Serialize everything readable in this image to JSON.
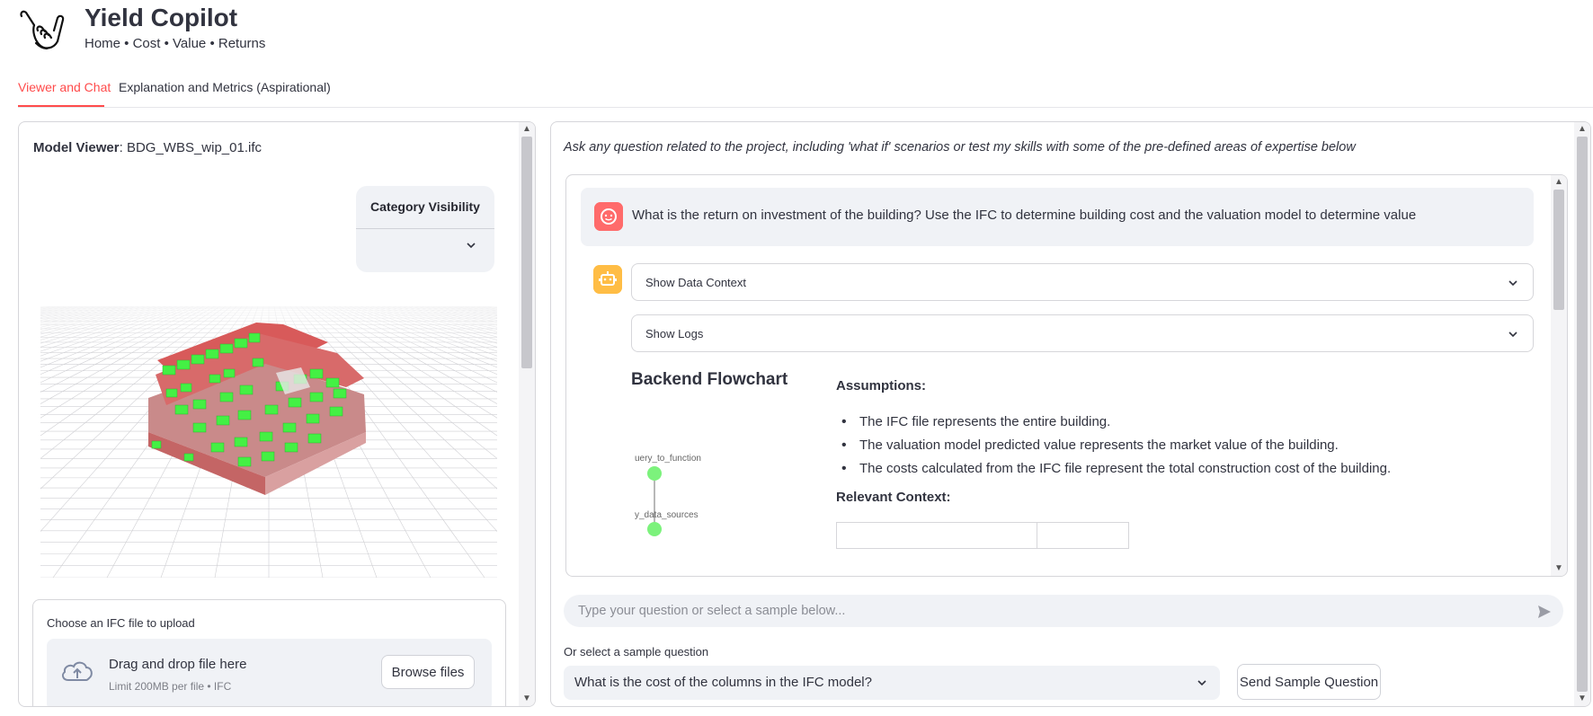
{
  "app": {
    "title": "Yield Copilot",
    "subtitle": "Home • Cost • Value • Returns",
    "logo_icon": "shaka-hand-icon"
  },
  "tabs": [
    {
      "label": "Viewer and Chat",
      "active": true
    },
    {
      "label": "Explanation and Metrics (Aspirational)",
      "active": false
    }
  ],
  "viewer": {
    "label_prefix": "Model Viewer",
    "label_separator": ":",
    "file_name": "BDG_WBS_wip_01.ifc",
    "category_visibility": {
      "title": "Category Visibility",
      "selected": ""
    },
    "colors": {
      "element_green": "#44f044",
      "element_red": "#d85a5a"
    }
  },
  "uploader": {
    "label": "Choose an IFC file to upload",
    "drop_text": "Drag and drop file here",
    "limit_text": "Limit 200MB per file • IFC",
    "browse_label": "Browse files"
  },
  "chat": {
    "intro": "Ask any question related to the project, including 'what if' scenarios or test my skills with some of the pre-defined areas of expertise below",
    "user_message": "What is the return on investment of the building? Use the IFC to determine building cost and the valuation model to determine value",
    "expanders": [
      "Show Data Context",
      "Show Logs"
    ],
    "flowchart_title": "Backend Flowchart",
    "flowchart_nodes": [
      "uery_to_function",
      "y_data_sources"
    ],
    "assumptions_title": "Assumptions:",
    "assumptions": [
      "The IFC file represents the entire building.",
      "The valuation model predicted value represents the market value of the building.",
      "The costs calculated from the IFC file represent the total construction cost of the building."
    ],
    "context_title": "Relevant Context:",
    "input_placeholder": "Type your question or select a sample below...",
    "sample_label": "Or select a sample question",
    "sample_selected": "What is the cost of the columns in the IFC model?",
    "send_sample_label": "Send Sample Question"
  },
  "theme": {
    "accent": "#ff4b4b",
    "user_avatar": "#ff6b6b",
    "bot_avatar": "#ffbd45",
    "flow_node": "#7cf27c",
    "secondary_bg": "#f0f2f6"
  }
}
